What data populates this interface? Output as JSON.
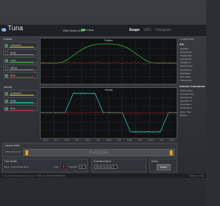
{
  "app": {
    "logo_text": "Tuna",
    "drive_label": "BRA Series Drive",
    "axis_label": "X Axis",
    "tabs": [
      "Scope",
      "DRO",
      "Histogram"
    ]
  },
  "position_group": {
    "title": "Position",
    "items": [
      {
        "label": "Command",
        "checked": true,
        "color": "#e3c21a"
      },
      {
        "label": "Motor",
        "checked": false,
        "color": "#8a8a8a"
      },
      {
        "label": "Load",
        "checked": true,
        "color": "#32c832"
      },
      {
        "label": "mError",
        "checked": false,
        "color": "#8a8a8a"
      },
      {
        "label": "Error",
        "checked": true,
        "color": "#e02020"
      }
    ]
  },
  "velocity_group": {
    "title": "Velocity",
    "items": [
      {
        "label": "Command",
        "checked": true,
        "color": "#e3c21a"
      },
      {
        "label": "Motor",
        "checked": true,
        "color": "#2ad0c0"
      },
      {
        "label": "Error",
        "checked": true,
        "color": "#e02020"
      }
    ]
  },
  "plots": {
    "position_title": "Position",
    "velocity_title": "Velocity",
    "x_ticks": [
      "1.5e4",
      "2e4",
      "2.5e4",
      "3e4",
      "3.5e4",
      "4e4",
      "4.5e4",
      "5e4",
      "5.5e4",
      "6e4",
      "6.5e4",
      "7e4",
      "7.5e4"
    ]
  },
  "chart_data": [
    {
      "type": "line",
      "title": "Position",
      "series": [
        {
          "name": "Load",
          "color": "#32c832",
          "x": [
            0,
            4,
            8,
            12,
            16,
            20,
            24,
            28,
            32,
            36,
            40,
            44,
            48,
            52,
            56,
            60,
            64,
            68,
            72,
            76,
            80,
            84,
            88,
            92,
            96,
            100
          ],
          "values": [
            0,
            0,
            0,
            0,
            0.05,
            0.2,
            0.4,
            0.6,
            0.78,
            0.9,
            0.97,
            1,
            1,
            1,
            0.97,
            0.9,
            0.78,
            0.6,
            0.4,
            0.2,
            0.05,
            0,
            0,
            0,
            0,
            0
          ]
        },
        {
          "name": "Error",
          "color": "#e02020",
          "x": [
            0,
            100
          ],
          "values": [
            0,
            0
          ]
        }
      ]
    },
    {
      "type": "line",
      "title": "Velocity",
      "series": [
        {
          "name": "Motor",
          "color": "#2ad0c0",
          "x": [
            0,
            10,
            18,
            24,
            40,
            46,
            54,
            60,
            66,
            72,
            88,
            94,
            100
          ],
          "values": [
            0,
            0,
            0,
            1,
            1,
            0,
            0,
            0,
            -1,
            -1,
            -1,
            0,
            0
          ]
        },
        {
          "name": "Error",
          "color": "#e02020",
          "x": [
            0,
            100
          ],
          "values": [
            0,
            0
          ]
        }
      ]
    }
  ],
  "right_panel": {
    "title": "Configuration",
    "section1": "PID",
    "pid_items": [
      "Algorithm",
      "Proportional",
      "Integral Gain",
      "Proportional",
      "Integral Lim",
      "Velocity Feed",
      "Acceleration",
      "Dead Band",
      "Slow Settle",
      "Following Err"
    ],
    "section2": "Internal Commands",
    "internal_items": [
      "Pulse Polarity",
      "Command Gen",
      "Velocity (ms)",
      "Equivalent P",
      "Acceleration",
      "Acceleration",
      "Pause Time",
      "Repeat"
    ]
  },
  "capture": {
    "title": "Capture Buffer",
    "sub": "4150 (40ms total)",
    "pan_zoom": "Pan/Zoom"
  },
  "trace": {
    "title": "Trace Details",
    "name_label": "Name:",
    "name_value": "Load Position Error",
    "color_label": "Color:",
    "scale_label": "Scale/Div:",
    "scale_value": "2"
  },
  "command_source": {
    "title": "Command Source",
    "value": "Internal Generator"
  },
  "sweep": {
    "title": "Sweep",
    "start_label": "START"
  },
  "status": {
    "left": "Tuna v2.10   ©  Marinebiotek Group Inc.  ©  2018 - ALL RIGHTS RESERVED",
    "right": "Waiting on Motor"
  }
}
